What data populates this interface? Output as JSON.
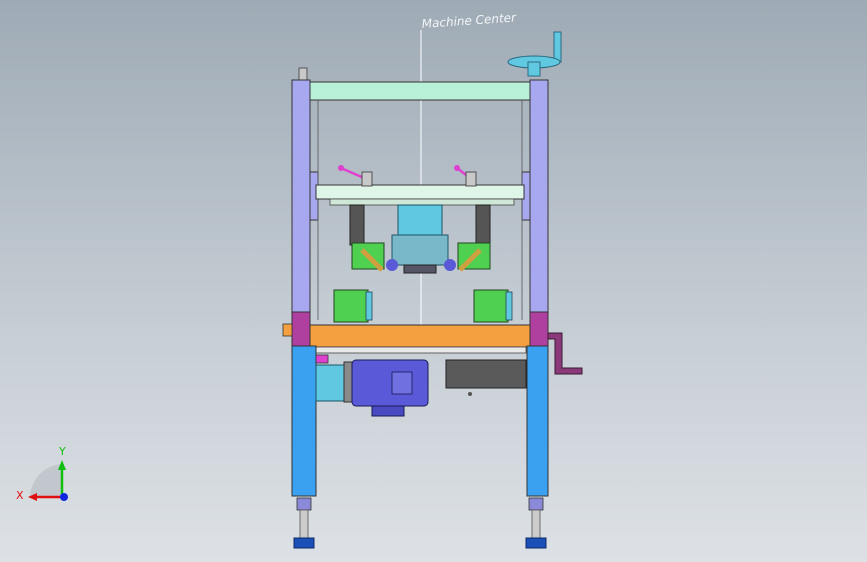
{
  "scene": {
    "center_label": "Machine Center"
  },
  "triad": {
    "x_label": "X",
    "y_label": "Y",
    "x_color": "#e01010",
    "y_color": "#10c010",
    "z_color": "#1028e0"
  },
  "colors": {
    "frame_column": "#a8a8f0",
    "top_beam": "#b8f0d8",
    "leg": "#3aa0f0",
    "table_plate": "#f5a040",
    "column_joint": "#b040a0",
    "motor": "#5a5ad8",
    "gearbox": "#60c8e0",
    "green_block": "#50d050",
    "lever": "#e040d0",
    "foot": "#1a50b8"
  }
}
